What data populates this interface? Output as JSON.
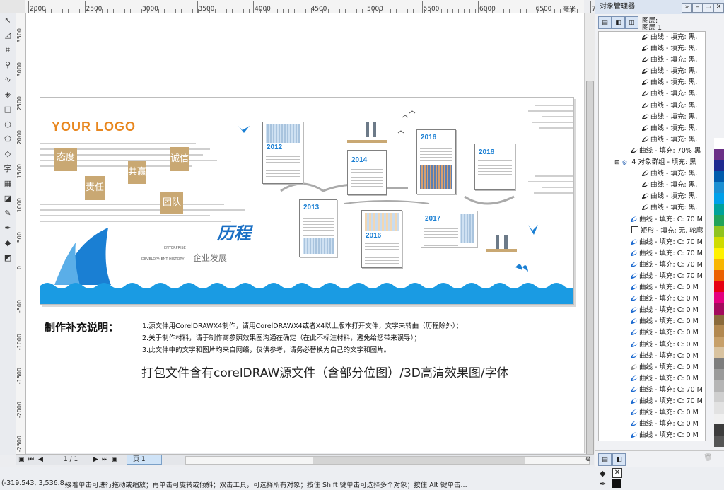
{
  "ruler": {
    "h_ticks": [
      "2000",
      "2500",
      "3000",
      "3500",
      "4000",
      "4500",
      "5000",
      "5500",
      "6000",
      "6500",
      "7000"
    ],
    "h_unit": "毫米",
    "v_ticks": [
      "3500",
      "3000",
      "2500",
      "2000",
      "1500",
      "1000",
      "500",
      "0",
      "-500",
      "-1000",
      "-1500",
      "-2000",
      "-2500"
    ]
  },
  "docker": {
    "title": "对象管理器",
    "layer_label": "图层:",
    "layer_name": "图层 1",
    "objects": [
      {
        "type": "curve",
        "color": "black",
        "label": "曲线 - 填充: 黑,"
      },
      {
        "type": "curve",
        "color": "black",
        "label": "曲线 - 填充: 黑,"
      },
      {
        "type": "curve",
        "color": "black",
        "label": "曲线 - 填充: 黑,"
      },
      {
        "type": "curve",
        "color": "black",
        "label": "曲线 - 填充: 黑,"
      },
      {
        "type": "curve",
        "color": "black",
        "label": "曲线 - 填充: 黑,"
      },
      {
        "type": "curve",
        "color": "black",
        "label": "曲线 - 填充: 黑,"
      },
      {
        "type": "curve",
        "color": "black",
        "label": "曲线 - 填充: 黑,"
      },
      {
        "type": "curve",
        "color": "black",
        "label": "曲线 - 填充: 黑,"
      },
      {
        "type": "curve",
        "color": "black",
        "label": "曲线 - 填充: 黑,"
      },
      {
        "type": "curve",
        "color": "black",
        "label": "曲线 - 填充: 黑,"
      },
      {
        "type": "curve",
        "color": "black",
        "label": "曲线 - 填充: 70% 黑"
      },
      {
        "type": "group",
        "color": "black",
        "label": "4 对象群组 - 填充: 黑"
      },
      {
        "type": "curve",
        "color": "black",
        "label": "曲线 - 填充: 黑,"
      },
      {
        "type": "curve",
        "color": "black",
        "label": "曲线 - 填充: 黑,"
      },
      {
        "type": "curve",
        "color": "black",
        "label": "曲线 - 填充: 黑,"
      },
      {
        "type": "curve",
        "color": "black",
        "label": "曲线 - 填充: 黑,"
      },
      {
        "type": "curve",
        "color": "blue",
        "label": "曲线 - 填充: C: 70 M"
      },
      {
        "type": "rect",
        "color": "black",
        "label": "矩形 - 填充: 无, 轮廓"
      },
      {
        "type": "curve",
        "color": "blue",
        "label": "曲线 - 填充: C: 70 M"
      },
      {
        "type": "curve",
        "color": "blue",
        "label": "曲线 - 填充: C: 70 M"
      },
      {
        "type": "curve",
        "color": "blue",
        "label": "曲线 - 填充: C: 70 M"
      },
      {
        "type": "curve",
        "color": "blue",
        "label": "曲线 - 填充: C: 70 M"
      },
      {
        "type": "curve",
        "color": "blue",
        "label": "曲线 - 填充: C: 0 M"
      },
      {
        "type": "curve",
        "color": "blue",
        "label": "曲线 - 填充: C: 0 M"
      },
      {
        "type": "curve",
        "color": "blue",
        "label": "曲线 - 填充: C: 0 M"
      },
      {
        "type": "curve",
        "color": "blue",
        "label": "曲线 - 填充: C: 0 M"
      },
      {
        "type": "curve",
        "color": "blue",
        "label": "曲线 - 填充: C: 0 M"
      },
      {
        "type": "curve",
        "color": "blue",
        "label": "曲线 - 填充: C: 0 M"
      },
      {
        "type": "curve",
        "color": "blue",
        "label": "曲线 - 填充: C: 0 M"
      },
      {
        "type": "curve",
        "color": "grey",
        "label": "曲线 - 填充: C: 0 M"
      },
      {
        "type": "curve",
        "color": "blue",
        "label": "曲线 - 填充: C: 0 M"
      },
      {
        "type": "curve",
        "color": "blue",
        "label": "曲线 - 填充: C: 70 M"
      },
      {
        "type": "curve",
        "color": "blue",
        "label": "曲线 - 填充: C: 70 M"
      },
      {
        "type": "curve",
        "color": "blue",
        "label": "曲线 - 填充: C: 0 M"
      },
      {
        "type": "curve",
        "color": "blue",
        "label": "曲线 - 填充: C: 0 M"
      },
      {
        "type": "curve",
        "color": "blue",
        "label": "曲线 - 填充: C: 0 M"
      }
    ]
  },
  "palette": [
    "#ffffff",
    "#6a2f86",
    "#1e2a8f",
    "#005bac",
    "#1b8fd2",
    "#00a0e9",
    "#00a29a",
    "#21a35a",
    "#8fc31f",
    "#cfdb00",
    "#fff100",
    "#f8b500",
    "#eb6100",
    "#e60012",
    "#e4007f",
    "#a40b5d",
    "#8a6a3b",
    "#b28850",
    "#c7a06a",
    "#d9c3a0",
    "#7d7d7d",
    "#9a9a9a",
    "#b5b5b5",
    "#cfcfcf",
    "#e2e2e2",
    "#f0f0f0",
    "#3c3c3c",
    "#555555"
  ],
  "nav": {
    "page_counter": "1 / 1",
    "page_tab": "页 1"
  },
  "status": {
    "coords": "(-319.543, 3,536.8...",
    "hint": "接着单击可进行拖动或缩放；再单击可旋转或倾斜；双击工具，可选择所有对象；按住 Shift 键单击可选择多个对象；按住 Alt 键单击..."
  },
  "artwork": {
    "logo": "YOUR LOGO",
    "values": [
      "态度",
      "责任",
      "共赢",
      "诚信",
      "团队"
    ],
    "years": [
      "2012",
      "2013",
      "2014",
      "2015",
      "2016",
      "2017",
      "2018"
    ],
    "title_cn": "历程",
    "subtitle_cn": "企业发展",
    "subtitle_en1": "ENTERPRISE",
    "subtitle_en2": "DEVELOPMENT HISTORY"
  },
  "notes": {
    "heading": "制作补充说明：",
    "lines": [
      "1.源文件用CorelDRAWX4制作，请用CorelDRAWX4或者X4以上版本打开文件，文字未转曲（历程除外）；",
      "2.关于制作材料，请于制作商参照效果图沟通在确定（在此不标注材料，避免给您带来误导）；",
      "3.此文件中的文字和图片均来自网络，仅供参考，请务必替换为自己的文字和图片。"
    ],
    "bottom": "打包文件含有corelDRAW源文件（含部分位图）/3D高清效果图/字体"
  },
  "colors": {
    "accent_blue": "#1a7fd3",
    "logo_orange": "#e8871f",
    "gold": "#c9a873"
  }
}
